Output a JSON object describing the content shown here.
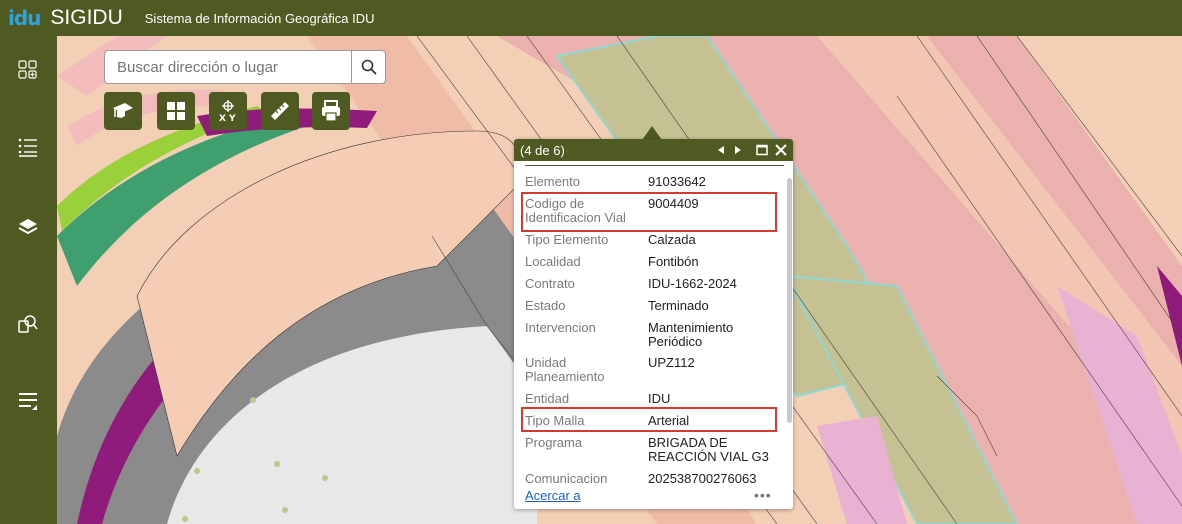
{
  "header": {
    "logo": "idu",
    "app_name": "SIGIDU",
    "subtitle": "Sistema de Información Geográfica IDU"
  },
  "sidebar": {
    "items": [
      {
        "icon": "widgets-icon"
      },
      {
        "icon": "list-icon"
      },
      {
        "icon": "layers-icon"
      },
      {
        "icon": "query-icon"
      },
      {
        "icon": "menu-collapse-icon"
      }
    ]
  },
  "search": {
    "placeholder": "Buscar dirección o lugar",
    "icon": "search-icon"
  },
  "toolbar": {
    "tools": [
      "graduation-cap-icon",
      "basemap-grid-icon",
      "xy-coordinate-icon",
      "measure-ruler-icon",
      "print-icon"
    ]
  },
  "popup": {
    "counter": "(4 de 6)",
    "fields": [
      {
        "label": "Elemento",
        "value": "91033642"
      },
      {
        "label": "Codigo de Identificacion Vial",
        "value": "9004409"
      },
      {
        "label": "Tipo Elemento",
        "value": "Calzada"
      },
      {
        "label": "Localidad",
        "value": "Fontibón"
      },
      {
        "label": "Contrato",
        "value": "IDU-1662-2024"
      },
      {
        "label": "Estado",
        "value": "Terminado"
      },
      {
        "label": "Intervencion",
        "value": "Mantenimiento Periódico"
      },
      {
        "label": "Unidad Planeamiento",
        "value": "UPZ112"
      },
      {
        "label": "Entidad",
        "value": "IDU"
      },
      {
        "label": "Tipo Malla",
        "value": "Arterial"
      },
      {
        "label": "Programa",
        "value": "BRIGADA DE REACCIÓN VIAL G3"
      },
      {
        "label": "Comunicacion",
        "value": "202538700276063"
      }
    ],
    "zoom_link": "Acercar a",
    "more": "•••"
  },
  "colors": {
    "header_bg": "#4e5a22",
    "highlight": "#d33b2c",
    "map_bg": "#f3cfb6"
  }
}
